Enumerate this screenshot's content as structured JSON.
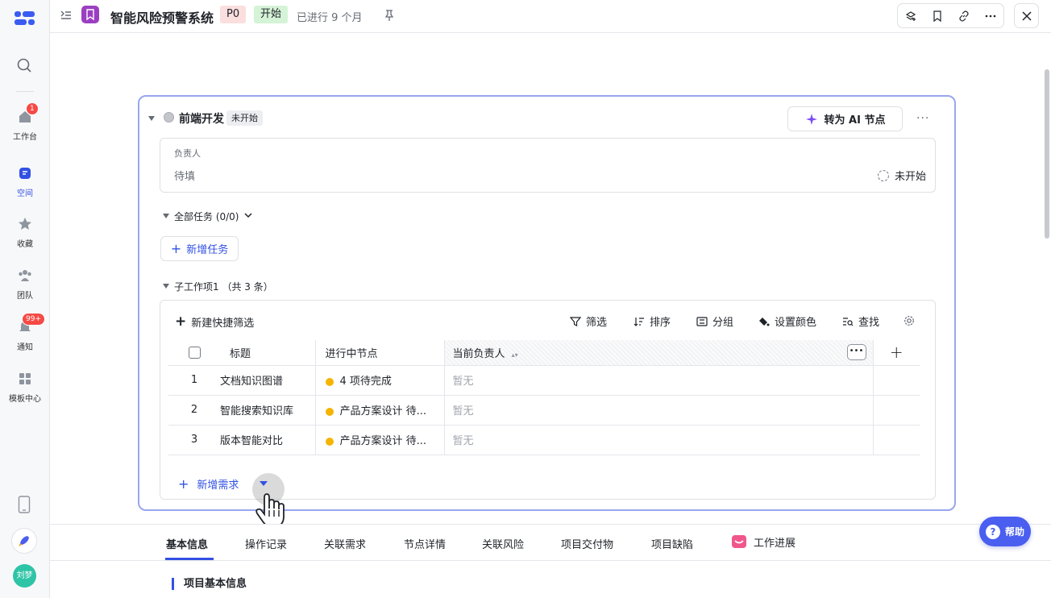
{
  "rail": {
    "items": [
      {
        "label": "工作台",
        "badge": "1"
      },
      {
        "label": "空间"
      },
      {
        "label": "收藏"
      },
      {
        "label": "团队"
      },
      {
        "label": "通知",
        "badge": "99+"
      },
      {
        "label": "模板中心"
      }
    ],
    "avatar": "刘梦"
  },
  "topbar": {
    "title": "智能风险预警系统",
    "priority": "P0",
    "status": "开始",
    "progress": "已进行 9 个月"
  },
  "node": {
    "name": "前端开发",
    "status": "未开始",
    "ai_button": "转为 AI 节点",
    "owner_label": "负责人",
    "owner_value": "待填",
    "owner_status": "未开始",
    "tasks_title": "全部任务 (0/0)",
    "add_task": "新增任务",
    "sub_title": "子工作项1 （共 3 条）",
    "toolbar": {
      "new_filter": "新建快捷筛选",
      "filter": "筛选",
      "sort": "排序",
      "group": "分组",
      "color": "设置颜色",
      "find": "查找"
    },
    "columns": {
      "title": "标题",
      "node": "进行中节点",
      "owner": "当前负责人"
    },
    "rows": [
      {
        "no": "1",
        "title": "文档知识图谱",
        "node": "4 项待完成",
        "owner": "暂无"
      },
      {
        "no": "2",
        "title": "智能搜索知识库",
        "node": "产品方案设计 待...",
        "owner": "暂无"
      },
      {
        "no": "3",
        "title": "版本智能对比",
        "node": "产品方案设计 待...",
        "owner": "暂无"
      }
    ],
    "add_req": "新增需求"
  },
  "tabs": [
    "基本信息",
    "操作记录",
    "关联需求",
    "节点详情",
    "关联风险",
    "项目交付物",
    "项目缺陷",
    "工作进展"
  ],
  "section": "项目基本信息",
  "help": "帮助",
  "colors": {
    "accent": "#3250e4",
    "node_border": "#98a6f0",
    "help_bg": "#4a5ef0"
  }
}
